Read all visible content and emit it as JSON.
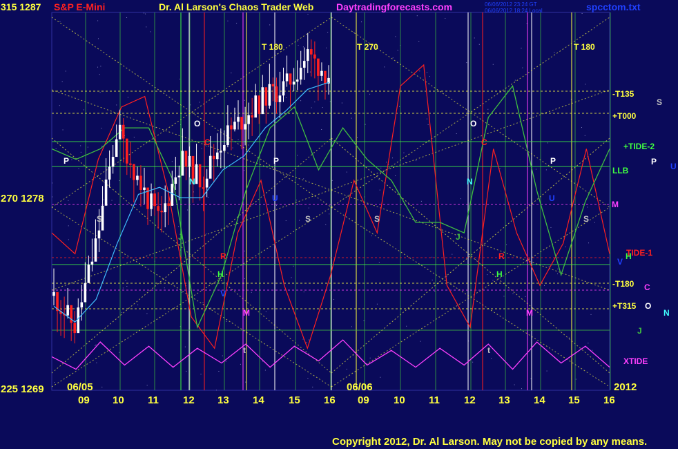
{
  "header": {
    "left_code": "315 1287",
    "instrument": "S&P E-Mini",
    "title": "Dr. Al Larson's Chaos Trader Web",
    "site": "Daytradingforecasts.com",
    "timestamp1": "06/06/2012 23:24 GT",
    "timestamp2": "06/06/2012 18:24 Local",
    "file": "spcctom.txt"
  },
  "price_axis": {
    "top": "315 1287",
    "mid": "270 1278",
    "bottom": "225 1269"
  },
  "date_labels": {
    "first": "06/05",
    "second": "06/06",
    "year": "2012"
  },
  "hour_ticks": [
    "09",
    "10",
    "11",
    "12",
    "13",
    "14",
    "15",
    "16",
    "09",
    "10",
    "11",
    "12",
    "13",
    "14",
    "15",
    "16"
  ],
  "right_labels": [
    {
      "text": "-T135",
      "color": "#ffff40"
    },
    {
      "text": "S",
      "color": "#c0c0c0"
    },
    {
      "text": "+T000",
      "color": "#ffff40"
    },
    {
      "text": "+TIDE-2",
      "color": "#40ff40"
    },
    {
      "text": "LLB",
      "color": "#40ff40"
    },
    {
      "text": "P",
      "color": "#ffffff"
    },
    {
      "text": "U",
      "color": "#2040ff"
    },
    {
      "text": "M",
      "color": "#ff40ff"
    },
    {
      "text": "TIDE-1",
      "color": "#ff2020"
    },
    {
      "text": "H",
      "color": "#40ff40"
    },
    {
      "text": "V",
      "color": "#2040ff"
    },
    {
      "text": "-T180",
      "color": "#ffff40"
    },
    {
      "text": "C",
      "color": "#ff40ff"
    },
    {
      "text": "+T315",
      "color": "#ffff40"
    },
    {
      "text": "O",
      "color": "#ffffff"
    },
    {
      "text": "N",
      "color": "#40ffff"
    },
    {
      "text": "J",
      "color": "#40c040"
    },
    {
      "text": "XTIDE",
      "color": "#ff40ff"
    }
  ],
  "chart_annotations": [
    {
      "text": "T 180",
      "color": "#ffff40"
    },
    {
      "text": "T 270",
      "color": "#ffff40"
    },
    {
      "text": "T 180",
      "color": "#ffff40"
    },
    {
      "text": "P",
      "color": "#ffffff"
    },
    {
      "text": "P",
      "color": "#ffffff"
    },
    {
      "text": "P",
      "color": "#ffffff"
    },
    {
      "text": "O",
      "color": "#ffffff"
    },
    {
      "text": "O",
      "color": "#ffffff"
    },
    {
      "text": "C",
      "color": "#ff2020"
    },
    {
      "text": "C",
      "color": "#ff2020"
    },
    {
      "text": "N",
      "color": "#40ffff"
    },
    {
      "text": "N",
      "color": "#40ffff"
    },
    {
      "text": "U",
      "color": "#2040ff"
    },
    {
      "text": "U",
      "color": "#2040ff"
    },
    {
      "text": "S",
      "color": "#c0c0c0"
    },
    {
      "text": "S",
      "color": "#c0c0c0"
    },
    {
      "text": "S",
      "color": "#c0c0c0"
    },
    {
      "text": "S",
      "color": "#c0c0c0"
    },
    {
      "text": "J",
      "color": "#40c040"
    },
    {
      "text": "J",
      "color": "#40c040"
    },
    {
      "text": "R",
      "color": "#ff2020"
    },
    {
      "text": "R",
      "color": "#ff2020"
    },
    {
      "text": "H",
      "color": "#40ff40"
    },
    {
      "text": "H",
      "color": "#40ff40"
    },
    {
      "text": "M",
      "color": "#ff40ff"
    },
    {
      "text": "M",
      "color": "#ff40ff"
    },
    {
      "text": "t",
      "color": "#c0c0c0"
    },
    {
      "text": "t",
      "color": "#c0c0c0"
    },
    {
      "text": "V",
      "color": "#2040ff"
    }
  ],
  "copyright": "Copyright 2012, Dr. Al Larson. May not be copied by any means.",
  "colors": {
    "background": "#0a0a5a",
    "axis_text": "#ffff40",
    "bars_up": "#ffffff",
    "bars_down": "#ff2020",
    "tide1": "#ff2020",
    "tide2": "#40c040",
    "xtide": "#ff40ff",
    "cyan_avg": "#40c0ff"
  },
  "chart_data": {
    "type": "line",
    "title": "S&P E-Mini",
    "ylim": [
      1269,
      1287
    ],
    "x_ticks": [
      "09",
      "10",
      "11",
      "12",
      "13",
      "14",
      "15",
      "16",
      "09",
      "10",
      "11",
      "12",
      "13",
      "14",
      "15",
      "16"
    ],
    "series": [
      {
        "name": "S&P E-Mini price (06/05-06/06 through mid 15)",
        "values": [
          1273.5,
          1272.0,
          1276.0,
          1281.5,
          1279.0,
          1277.0,
          1280.0,
          1279.0,
          1281.0,
          1282.0,
          1283.0,
          1283.5,
          1285.0,
          1284.0
        ]
      },
      {
        "name": "TIDE-1",
        "values": [
          1276.5,
          1275.5,
          1280.0,
          1282.5,
          1283.0,
          1278.5,
          1272.5,
          1271.0,
          1276.5,
          1279.0,
          1274.0,
          1271.0,
          1274.5,
          1279.0,
          1276.5,
          1283.5,
          1284.5,
          1274.0,
          1272.0,
          1280.5,
          1276.5,
          1274.0,
          1276.0,
          1280.5,
          1275.5
        ]
      },
      {
        "name": "+TIDE-2",
        "values": [
          1280.5,
          1280.0,
          1280.5,
          1281.5,
          1281.5,
          1279.0,
          1272.0,
          1274.5,
          1278.5,
          1281.5,
          1282.5,
          1279.5,
          1281.5,
          1280.0,
          1279.0,
          1277.0,
          1277.0,
          1276.5,
          1282.0,
          1283.5,
          1278.5,
          1274.5,
          1278.0,
          1280.5
        ]
      },
      {
        "name": "XTIDE",
        "values": [
          1270.6,
          1270.0,
          1271.3,
          1270.2,
          1271.1,
          1270.1,
          1271.0,
          1270.3,
          1271.2,
          1270.1,
          1271.1,
          1270.4,
          1271.4,
          1270.2,
          1270.9,
          1270.1,
          1271.0,
          1270.2,
          1271.2,
          1270.0,
          1271.3,
          1270.3,
          1271.1,
          1270.1
        ]
      }
    ]
  }
}
